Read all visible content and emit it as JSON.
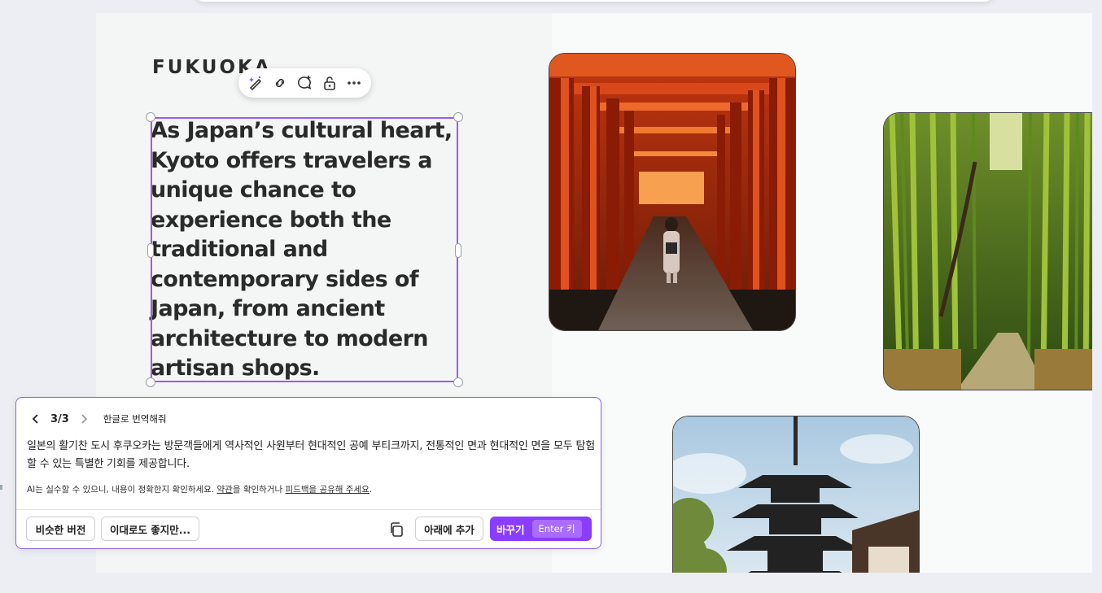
{
  "canvas": {
    "headline": "FUKUOKA",
    "body_text": "As Japan’s cultural heart, Kyoto offers travelers a unique chance to experience both the traditional and contemporary sides of Japan, from ancient architecture to modern artisan shops."
  },
  "toolbar": {
    "icons": [
      "magic-edit-icon",
      "link-icon",
      "comment-add-icon",
      "lock-icon",
      "more-icon"
    ]
  },
  "photos": [
    {
      "name": "torii-gates-photo"
    },
    {
      "name": "bamboo-forest-photo"
    },
    {
      "name": "pagoda-photo"
    }
  ],
  "ai_panel": {
    "counter": "3/3",
    "prompt": "한글로 번역해줘",
    "result": "일본의 활기찬 도시 후쿠오카는 방문객들에게 역사적인 사원부터 현대적인 공예 부티크까지, 전통적인 면과 현대적인 면을 모두 탐험할 수 있는 특별한 기회를 제공합니다.",
    "disclaimer_start": "AI는 실수할 수 있으니, 내용이 정확한지 확인하세요. ",
    "disclaimer_terms": "약관",
    "disclaimer_mid": "을 확인하거나 ",
    "disclaimer_feedback": "피드백을 공유해 주세요",
    "disclaimer_end": ".",
    "similar_label": "비슷한 버전",
    "keep_label": "이대로도 좋지만...",
    "add_below_label": "아래에 추가",
    "replace_label": "바꾸기",
    "replace_shortcut": "Enter 키"
  },
  "colors": {
    "accent": "#8b3dff",
    "selection": "#9b5de5"
  }
}
